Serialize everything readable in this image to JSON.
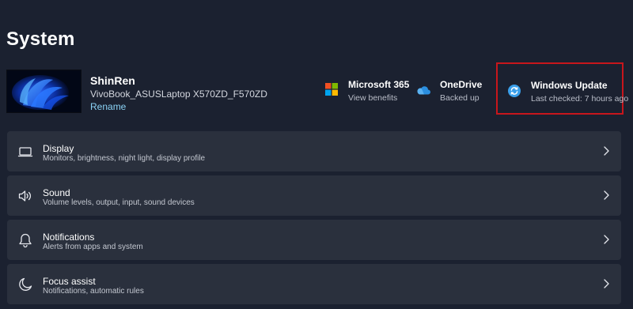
{
  "page": {
    "title": "System"
  },
  "device": {
    "name": "ShinRen",
    "model": "VivoBook_ASUSLaptop X570ZD_F570ZD",
    "rename_label": "Rename"
  },
  "tiles": [
    {
      "title": "Microsoft 365",
      "subtitle": "View benefits",
      "icon": "microsoft-logo-icon"
    },
    {
      "title": "OneDrive",
      "subtitle": "Backed up",
      "icon": "onedrive-cloud-icon"
    },
    {
      "title": "Windows Update",
      "subtitle": "Last checked: 7 hours ago",
      "icon": "windows-update-icon"
    }
  ],
  "settings": [
    {
      "title": "Display",
      "subtitle": "Monitors, brightness, night light, display profile",
      "icon": "display-icon"
    },
    {
      "title": "Sound",
      "subtitle": "Volume levels, output, input, sound devices",
      "icon": "speaker-icon"
    },
    {
      "title": "Notifications",
      "subtitle": "Alerts from apps and system",
      "icon": "bell-icon"
    },
    {
      "title": "Focus assist",
      "subtitle": "Notifications, automatic rules",
      "icon": "moon-icon"
    }
  ],
  "colors": {
    "background": "#1b2130",
    "row_background": "#2a303d",
    "accent_link": "#8ad2f5",
    "highlight_border": "#c8161c",
    "update_icon": "#3a9fea"
  }
}
